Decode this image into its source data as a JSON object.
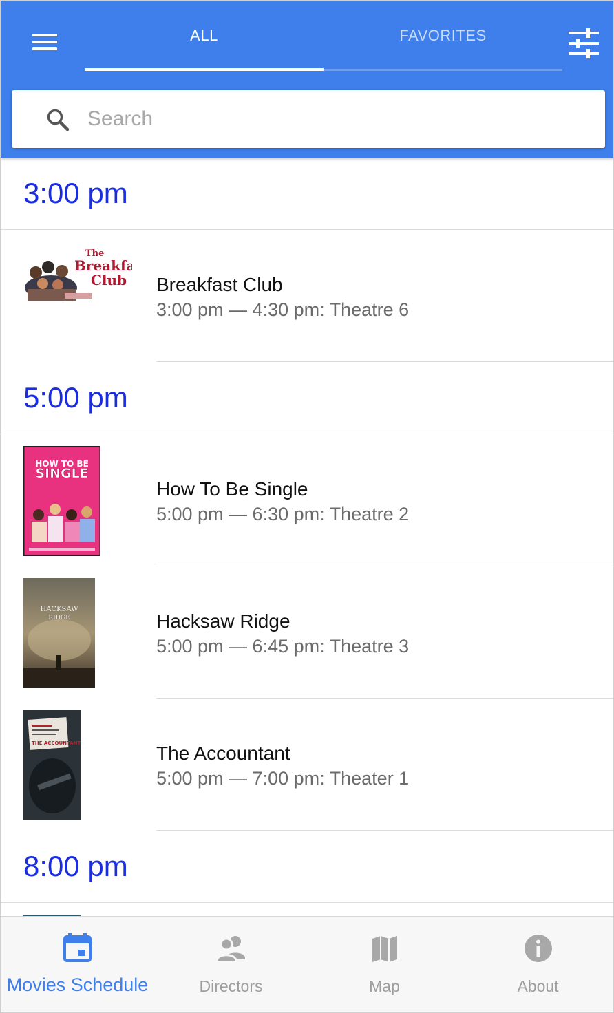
{
  "header": {
    "tabs": [
      {
        "label": "ALL",
        "active": true
      },
      {
        "label": "FAVORITES",
        "active": false
      }
    ],
    "icons": {
      "menu": "menu-icon",
      "filter": "tune-icon"
    },
    "accent_color": "#3f7fec"
  },
  "search": {
    "placeholder": "Search",
    "value": ""
  },
  "schedule": [
    {
      "time": "3:00 pm",
      "movies": [
        {
          "title": "Breakfast Club",
          "details": "3:00 pm — 4:30 pm: Theatre 6",
          "poster_text": [
            "The",
            "Breakfast",
            "Club"
          ]
        }
      ]
    },
    {
      "time": "5:00 pm",
      "movies": [
        {
          "title": "How To Be Single",
          "details": "5:00 pm — 6:30 pm: Theatre 2",
          "poster_text": [
            "HOW TO BE",
            "SINGLE"
          ]
        },
        {
          "title": "Hacksaw Ridge",
          "details": "5:00 pm — 6:45 pm: Theatre 3",
          "poster_text": [
            "HACKSAW",
            "RIDGE"
          ]
        },
        {
          "title": "The Accountant",
          "details": "5:00 pm — 7:00 pm: Theater 1",
          "poster_text": [
            "THE ACCOUNTANT"
          ]
        }
      ]
    },
    {
      "time": "8:00 pm",
      "movies": []
    }
  ],
  "bottom_nav": [
    {
      "label": "Movies Schedule",
      "icon": "calendar-icon",
      "active": true
    },
    {
      "label": "Directors",
      "icon": "people-icon",
      "active": false
    },
    {
      "label": "Map",
      "icon": "map-icon",
      "active": false
    },
    {
      "label": "About",
      "icon": "info-icon",
      "active": false
    }
  ],
  "colors": {
    "time_header": "#1a2ee0",
    "nav_active": "#3f7fec",
    "nav_inactive": "#9e9e9e"
  }
}
